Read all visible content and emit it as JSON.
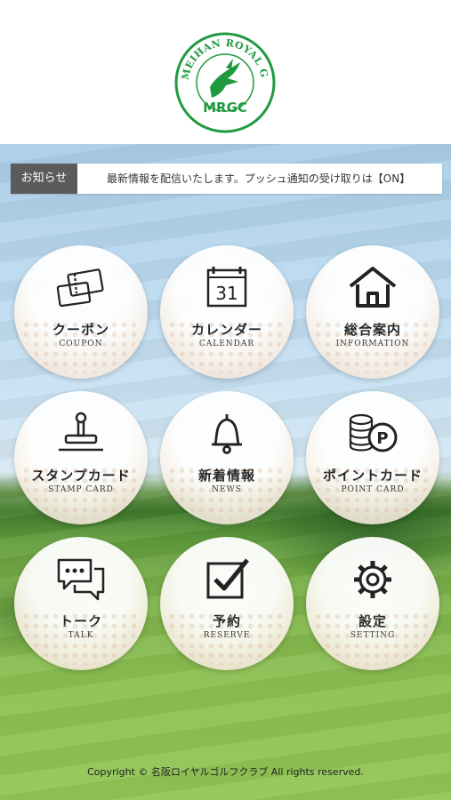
{
  "logo": {
    "ring_text": "MEIHAN ROYAL GOLF CLUB",
    "abbrev": "MRGC",
    "color": "#1f9a3f"
  },
  "notice": {
    "label": "お知らせ",
    "text": "最新情報を配信いたします。プッシュ通知の受け取りは【ON】"
  },
  "menu": [
    {
      "ja": "クーポン",
      "en": "COUPON",
      "icon": "coupon-icon"
    },
    {
      "ja": "カレンダー",
      "en": "CALENDAR",
      "icon": "calendar-icon",
      "icon_text": "31"
    },
    {
      "ja": "総合案内",
      "en": "INFORMATION",
      "icon": "house-icon"
    },
    {
      "ja": "スタンプカード",
      "en": "STAMP CARD",
      "icon": "stamp-icon"
    },
    {
      "ja": "新着情報",
      "en": "NEWS",
      "icon": "bell-icon"
    },
    {
      "ja": "ポイントカード",
      "en": "POINT CARD",
      "icon": "coins-icon",
      "icon_text": "P"
    },
    {
      "ja": "トーク",
      "en": "TALK",
      "icon": "chat-icon"
    },
    {
      "ja": "予約",
      "en": "RESERVE",
      "icon": "checkbox-icon"
    },
    {
      "ja": "設定",
      "en": "SETTING",
      "icon": "gear-icon"
    }
  ],
  "footer": {
    "copyright": "Copyright © 名阪ロイヤルゴルフクラブ All rights reserved."
  }
}
